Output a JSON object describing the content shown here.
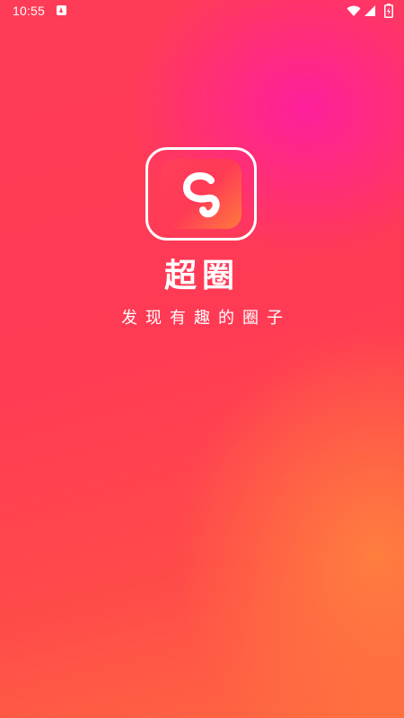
{
  "status_bar": {
    "time": "10:55",
    "icons": [
      "accessibility-a-icon",
      "wifi-icon",
      "cell-signal-icon",
      "battery-charging-icon"
    ]
  },
  "splash": {
    "logo_icon": "swirl-s-logo-icon",
    "app_name": "超圈",
    "slogan": "发现有趣的圈子"
  },
  "colors": {
    "background_main": "#ff3c58",
    "background_pink": "#ff1ea0",
    "background_orange": "#ff803e",
    "text": "#ffffff"
  }
}
